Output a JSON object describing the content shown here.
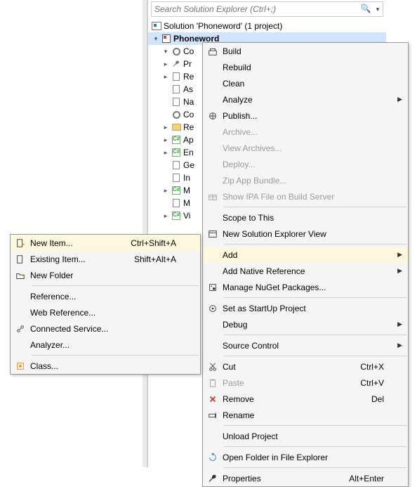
{
  "panel": {
    "search_placeholder": "Search Solution Explorer (Ctrl+;)",
    "solution_label": "Solution 'Phoneword' (1 project)",
    "project_label": "Phoneword",
    "nodes": [
      {
        "glyph": "gear",
        "tw": "▾",
        "label": "Co"
      },
      {
        "glyph": "wrench",
        "tw": "▸",
        "label": "Pr"
      },
      {
        "glyph": "doc",
        "tw": "▸",
        "label": "Re"
      },
      {
        "glyph": "doc",
        "tw": "",
        "label": "As"
      },
      {
        "glyph": "doc",
        "tw": "",
        "label": "Na"
      },
      {
        "glyph": "gear",
        "tw": "",
        "label": "Co"
      },
      {
        "glyph": "folder",
        "tw": "▸",
        "label": "Re"
      },
      {
        "glyph": "cs",
        "tw": "▸",
        "label": "Ap"
      },
      {
        "glyph": "cs",
        "tw": "▸",
        "label": "En"
      },
      {
        "glyph": "doc",
        "tw": "",
        "label": "Ge"
      },
      {
        "glyph": "doc",
        "tw": "",
        "label": "In"
      },
      {
        "glyph": "cs",
        "tw": "▸",
        "label": "M"
      },
      {
        "glyph": "doc",
        "tw": "",
        "label": "M"
      },
      {
        "glyph": "cs",
        "tw": "▸",
        "label": "Vi"
      }
    ]
  },
  "main_menu": [
    {
      "type": "item",
      "label": "Build",
      "icon": "build"
    },
    {
      "type": "item",
      "label": "Rebuild"
    },
    {
      "type": "item",
      "label": "Clean"
    },
    {
      "type": "item",
      "label": "Analyze",
      "submenu": true
    },
    {
      "type": "item",
      "label": "Publish...",
      "icon": "publish"
    },
    {
      "type": "item",
      "label": "Archive...",
      "disabled": true
    },
    {
      "type": "item",
      "label": "View Archives...",
      "disabled": true
    },
    {
      "type": "item",
      "label": "Deploy...",
      "disabled": true
    },
    {
      "type": "item",
      "label": "Zip App Bundle...",
      "disabled": true
    },
    {
      "type": "item",
      "label": "Show IPA File on Build Server",
      "icon": "box",
      "disabled": true
    },
    {
      "type": "sep"
    },
    {
      "type": "item",
      "label": "Scope to This"
    },
    {
      "type": "item",
      "label": "New Solution Explorer View",
      "icon": "window"
    },
    {
      "type": "sep"
    },
    {
      "type": "item",
      "label": "Add",
      "submenu": true,
      "highlight": true
    },
    {
      "type": "item",
      "label": "Add Native Reference",
      "submenu": true
    },
    {
      "type": "item",
      "label": "Manage NuGet Packages...",
      "icon": "nuget"
    },
    {
      "type": "sep"
    },
    {
      "type": "item",
      "label": "Set as StartUp Project",
      "icon": "startup"
    },
    {
      "type": "item",
      "label": "Debug",
      "submenu": true
    },
    {
      "type": "sep"
    },
    {
      "type": "item",
      "label": "Source Control",
      "submenu": true
    },
    {
      "type": "sep"
    },
    {
      "type": "item",
      "label": "Cut",
      "icon": "cut",
      "shortcut": "Ctrl+X"
    },
    {
      "type": "item",
      "label": "Paste",
      "icon": "paste",
      "shortcut": "Ctrl+V",
      "disabled": true
    },
    {
      "type": "item",
      "label": "Remove",
      "icon": "remove",
      "shortcut": "Del"
    },
    {
      "type": "item",
      "label": "Rename",
      "icon": "rename"
    },
    {
      "type": "sep"
    },
    {
      "type": "item",
      "label": "Unload Project"
    },
    {
      "type": "sep"
    },
    {
      "type": "item",
      "label": "Open Folder in File Explorer",
      "icon": "open"
    },
    {
      "type": "sep"
    },
    {
      "type": "item",
      "label": "Properties",
      "icon": "wrench",
      "shortcut": "Alt+Enter"
    }
  ],
  "sub_menu": [
    {
      "type": "item",
      "label": "New Item...",
      "icon": "newitem",
      "shortcut": "Ctrl+Shift+A",
      "highlight": true
    },
    {
      "type": "item",
      "label": "Existing Item...",
      "icon": "existing",
      "shortcut": "Shift+Alt+A"
    },
    {
      "type": "item",
      "label": "New Folder",
      "icon": "newfolder"
    },
    {
      "type": "sep"
    },
    {
      "type": "item",
      "label": "Reference..."
    },
    {
      "type": "item",
      "label": "Web Reference..."
    },
    {
      "type": "item",
      "label": "Connected Service...",
      "icon": "connected"
    },
    {
      "type": "item",
      "label": "Analyzer..."
    },
    {
      "type": "sep"
    },
    {
      "type": "item",
      "label": "Class...",
      "icon": "class"
    }
  ]
}
